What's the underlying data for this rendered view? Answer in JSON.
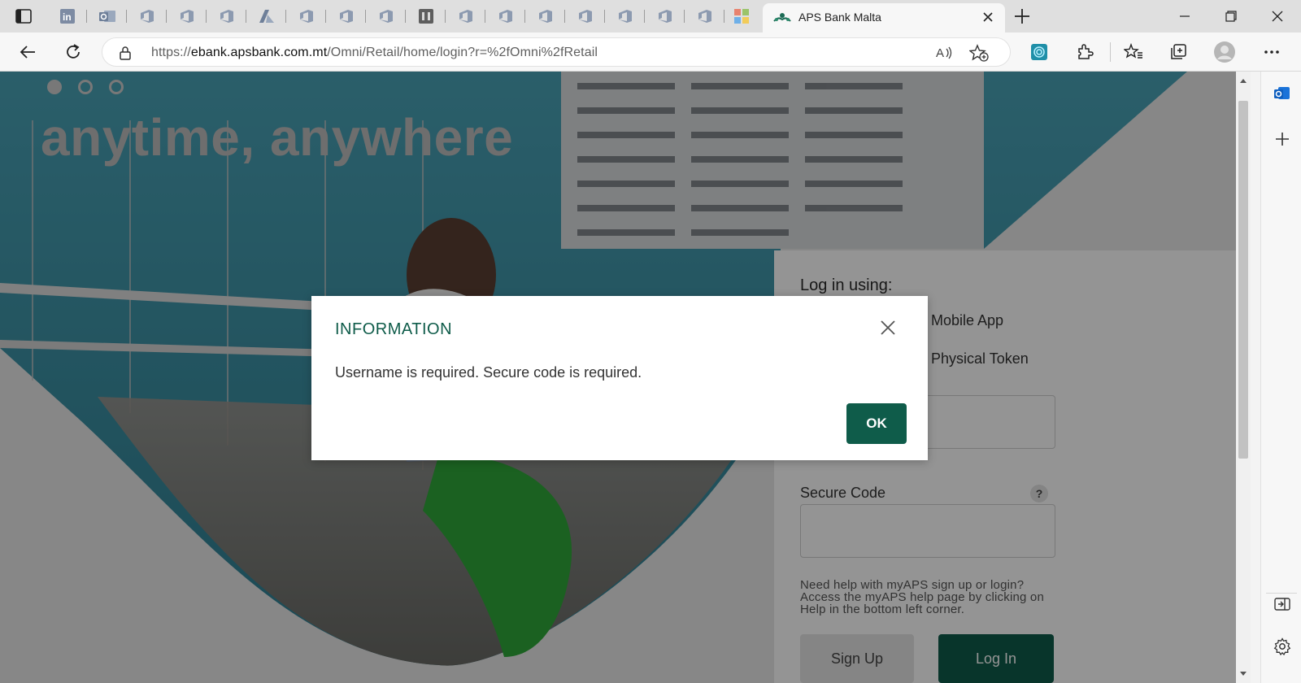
{
  "browser": {
    "pinned_tabs": [
      {
        "icon": "linkedin-icon"
      },
      {
        "icon": "outlook-icon"
      },
      {
        "icon": "azure-devops-icon"
      },
      {
        "icon": "azure-devops-icon"
      },
      {
        "icon": "azure-devops-icon"
      },
      {
        "icon": "azure-icon"
      },
      {
        "icon": "azure-devops-icon"
      },
      {
        "icon": "azure-devops-icon"
      },
      {
        "icon": "azure-devops-icon"
      },
      {
        "icon": "app-icon"
      },
      {
        "icon": "azure-devops-icon"
      },
      {
        "icon": "azure-devops-icon"
      },
      {
        "icon": "azure-devops-icon"
      },
      {
        "icon": "azure-devops-icon"
      },
      {
        "icon": "azure-devops-icon"
      },
      {
        "icon": "azure-devops-icon"
      },
      {
        "icon": "azure-devops-icon"
      },
      {
        "icon": "microsoft-icon"
      }
    ],
    "active_tab": {
      "title": "APS Bank Malta"
    },
    "address": {
      "prefix": "https://",
      "host": "ebank.apsbank.com.mt",
      "path": "/Omni/Retail/home/login?r=%2fOmni%2fRetail"
    },
    "accent_color": "#0f5c4a"
  },
  "page": {
    "hero_text": "anytime, anywhere",
    "login": {
      "heading": "Log in using:",
      "options": [
        "Mobile App",
        "Physical Token"
      ],
      "secure_code_label": "Secure Code",
      "help_badge": "?",
      "help_text": "Need help with myAPS sign up or login? Access the myAPS help page by clicking on Help in the bottom left corner.",
      "signup_label": "Sign Up",
      "login_label": "Log In"
    }
  },
  "dialog": {
    "title": "INFORMATION",
    "message": "Username is required. Secure code is required.",
    "ok_label": "OK"
  }
}
